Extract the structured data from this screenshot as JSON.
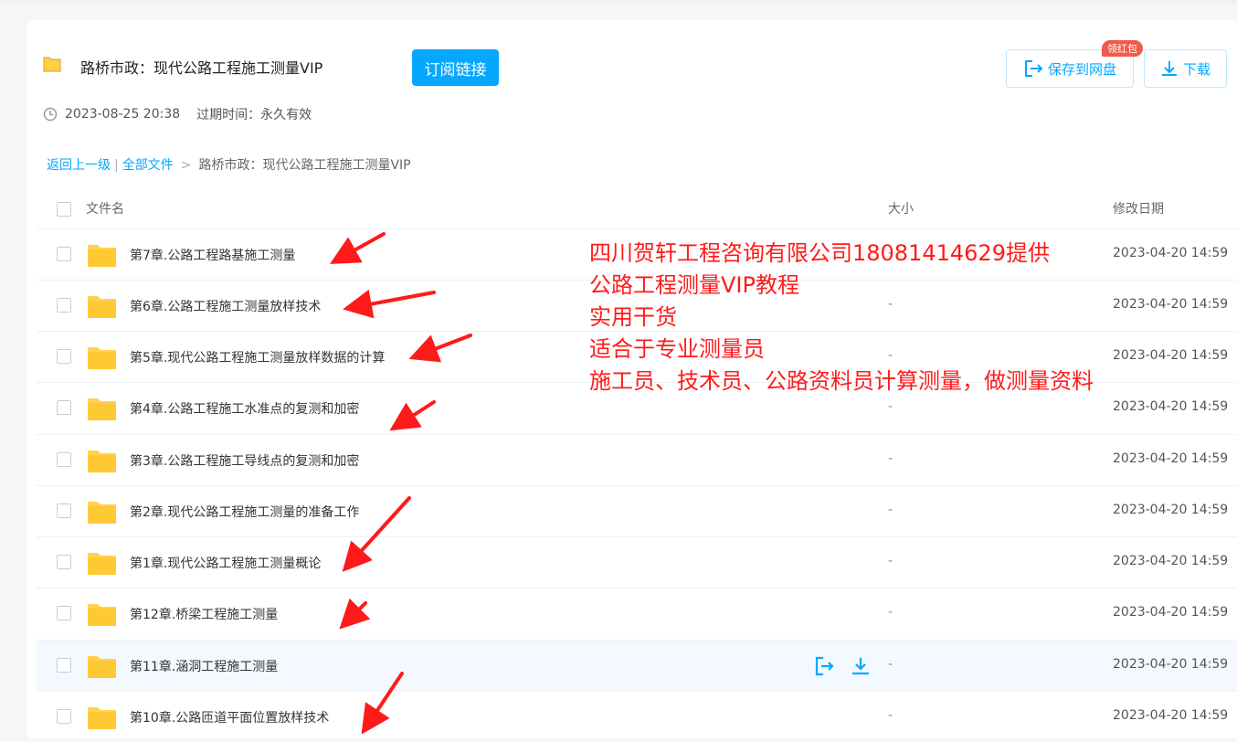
{
  "share": {
    "title": "路桥市政：现代公路工程施工测量VIP",
    "subscribe_label": "订阅链接",
    "created": "2023-08-25 20:38",
    "expiry": "过期时间：永久有效",
    "save_label": "保存到网盘",
    "save_badge": "领红包",
    "download_label": "下载"
  },
  "breadcrumb": {
    "back": "返回上一级",
    "all": "全部文件",
    "current": "路桥市政：现代公路工程施工测量VIP"
  },
  "table": {
    "headers": {
      "name": "文件名",
      "size": "大小",
      "date": "修改日期"
    },
    "rows": [
      {
        "name": "第7章.公路工程路基施工测量",
        "size": "-",
        "date": "2023-04-20 14:59"
      },
      {
        "name": "第6章.公路工程施工测量放样技术",
        "size": "-",
        "date": "2023-04-20 14:59"
      },
      {
        "name": "第5章.现代公路工程施工测量放样数据的计算",
        "size": "-",
        "date": "2023-04-20 14:59"
      },
      {
        "name": "第4章.公路工程施工水准点的复测和加密",
        "size": "-",
        "date": "2023-04-20 14:59"
      },
      {
        "name": "第3章.公路工程施工导线点的复测和加密",
        "size": "-",
        "date": "2023-04-20 14:59"
      },
      {
        "name": "第2章.现代公路工程施工测量的准备工作",
        "size": "-",
        "date": "2023-04-20 14:59"
      },
      {
        "name": "第1章.现代公路工程施工测量概论",
        "size": "-",
        "date": "2023-04-20 14:59"
      },
      {
        "name": "第12章.桥梁工程施工测量",
        "size": "-",
        "date": "2023-04-20 14:59"
      },
      {
        "name": "第11章.涵洞工程施工测量",
        "size": "-",
        "date": "2023-04-20 14:59"
      },
      {
        "name": "第10章.公路匝道平面位置放样技术",
        "size": "-",
        "date": "2023-04-20 14:59"
      }
    ]
  },
  "annotation": {
    "lines": [
      "四川贺轩工程咨询有限公司18081414629提供",
      "公路工程测量VIP教程",
      "实用干货",
      "适合于专业测量员",
      "施工员、技术员、公路资料员计算测量，做测量资料"
    ]
  },
  "colors": {
    "accent": "#06a7ff",
    "folder": "#ffd34f",
    "annotation": "#ff1a1a",
    "badge": "#f25a4a"
  },
  "icons": [
    "folder-icon",
    "clock-icon",
    "save-to-cloud-icon",
    "download-icon",
    "red-arrow-icon"
  ]
}
